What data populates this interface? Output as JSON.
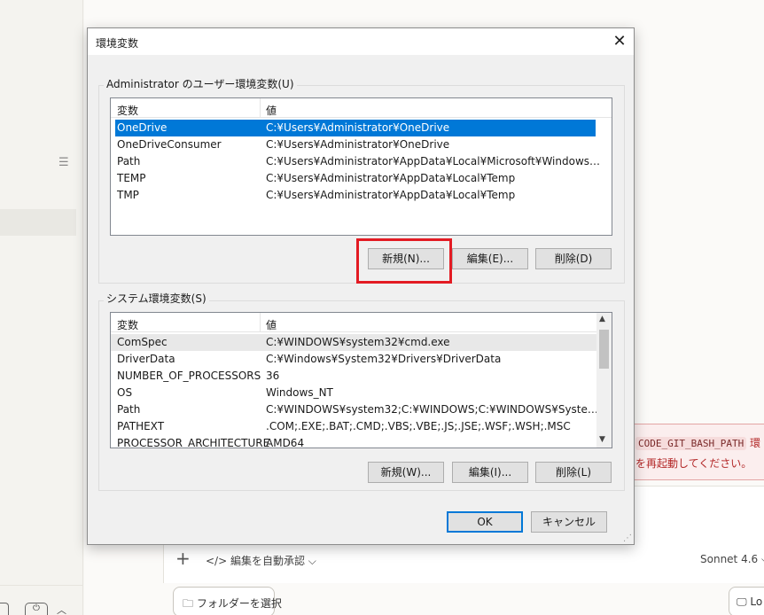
{
  "dialog": {
    "title": "環境変数",
    "close_glyph": "✕",
    "user_group_label": "Administrator のユーザー環境変数(U)",
    "system_group_label": "システム環境変数(S)",
    "col_var": "変数",
    "col_value": "値",
    "user_vars": [
      {
        "name": "OneDrive",
        "value": "C:¥Users¥Administrator¥OneDrive"
      },
      {
        "name": "OneDriveConsumer",
        "value": "C:¥Users¥Administrator¥OneDrive"
      },
      {
        "name": "Path",
        "value": "C:¥Users¥Administrator¥AppData¥Local¥Microsoft¥WindowsApps;C..."
      },
      {
        "name": "TEMP",
        "value": "C:¥Users¥Administrator¥AppData¥Local¥Temp"
      },
      {
        "name": "TMP",
        "value": "C:¥Users¥Administrator¥AppData¥Local¥Temp"
      }
    ],
    "system_vars": [
      {
        "name": "ComSpec",
        "value": "C:¥WINDOWS¥system32¥cmd.exe"
      },
      {
        "name": "DriverData",
        "value": "C:¥Windows¥System32¥Drivers¥DriverData"
      },
      {
        "name": "NUMBER_OF_PROCESSORS",
        "value": "36"
      },
      {
        "name": "OS",
        "value": "Windows_NT"
      },
      {
        "name": "Path",
        "value": "C:¥WINDOWS¥system32;C:¥WINDOWS;C:¥WINDOWS¥System32¥W..."
      },
      {
        "name": "PATHEXT",
        "value": ".COM;.EXE;.BAT;.CMD;.VBS;.VBE;.JS;.JSE;.WSF;.WSH;.MSC"
      },
      {
        "name": "PROCESSOR_ARCHITECTURE",
        "value": "AMD64"
      }
    ],
    "user_buttons": {
      "new": "新規(N)...",
      "edit": "編集(E)...",
      "delete": "削除(D)"
    },
    "system_buttons": {
      "new": "新規(W)...",
      "edit": "編集(I)...",
      "delete": "削除(L)"
    },
    "ok": "OK",
    "cancel": "キャンセル",
    "selected_user_index": 0
  },
  "background": {
    "error_code": "CODE_GIT_BASH_PATH",
    "error_suffix": "環",
    "error_line2": "を再起動してください。",
    "composer_plus": "+",
    "auto_approve": "</> 編集を自動承認 ⌵",
    "model": "Sonnet 4.6 ⌵",
    "folder_button": "🗀 フォルダーを選択",
    "right_button": "🖵 Lo"
  },
  "colors": {
    "selection": "#0078d7",
    "highlight_box": "#e31b23",
    "error_text": "#b32828"
  }
}
